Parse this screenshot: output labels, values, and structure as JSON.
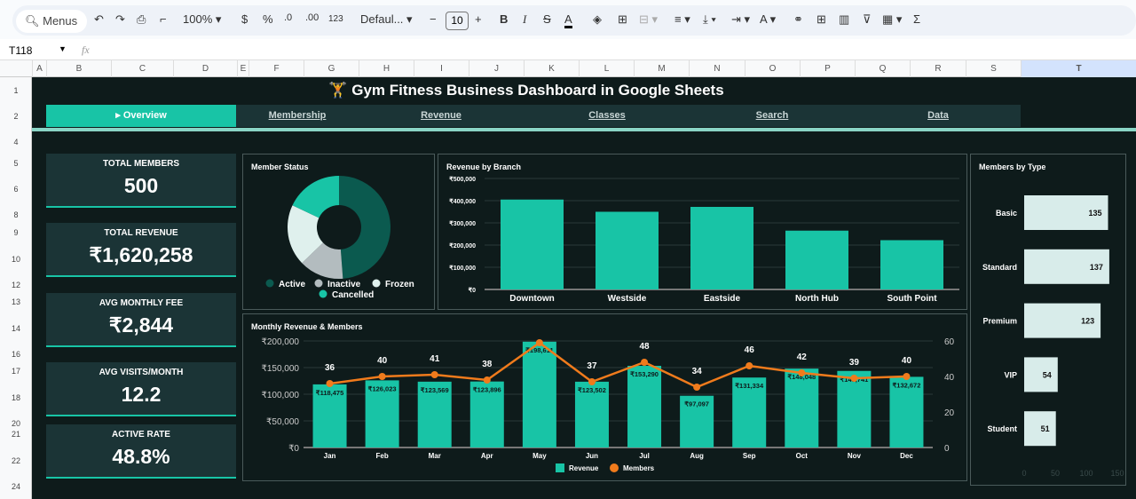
{
  "toolbar": {
    "menus": "Menus",
    "zoom": "100%",
    "currency": "$",
    "percent": "%",
    "dec_less": ".0",
    "dec_more": ".00",
    "format_123": "123",
    "font": "Defaul...",
    "font_size": "10",
    "bold": "B",
    "italic": "I",
    "sum": "Σ"
  },
  "formula_bar": {
    "cell_ref": "T118",
    "fx": "fx",
    "value": ""
  },
  "columns": [
    "A",
    "B",
    "C",
    "D",
    "E",
    "F",
    "G",
    "H",
    "I",
    "J",
    "K",
    "L",
    "M",
    "N",
    "O",
    "P",
    "Q",
    "R",
    "S",
    "T"
  ],
  "rows": [
    "1",
    "2",
    "4",
    "5",
    "6",
    "8",
    "9",
    "10",
    "12",
    "13",
    "14",
    "16",
    "17",
    "18",
    "20",
    "21",
    "22",
    "24"
  ],
  "dashboard": {
    "title": "🏋️ Gym Fitness Business Dashboard in Google Sheets",
    "nav": [
      "▸ Overview",
      "Membership",
      "Revenue",
      "Classes",
      "Search",
      "Data"
    ],
    "kpis": [
      {
        "label": "TOTAL MEMBERS",
        "value": "500"
      },
      {
        "label": "TOTAL REVENUE",
        "value": "₹1,620,258"
      },
      {
        "label": "AVG MONTHLY FEE",
        "value": "₹2,844"
      },
      {
        "label": "AVG VISITS/MONTH",
        "value": "12.2"
      },
      {
        "label": "ACTIVE RATE",
        "value": "48.8%"
      }
    ]
  },
  "colors": {
    "teal": "#18c4a6",
    "orange": "#f07b1c",
    "dark": "#0e1b1b",
    "panel": "#1b3436"
  },
  "chart_data": [
    {
      "type": "pie",
      "title": "Member Status",
      "labels": [
        "Active",
        "Inactive",
        "Frozen",
        "Cancelled"
      ],
      "values": [
        244,
        70,
        96,
        90
      ],
      "colors": [
        "#0b5a4f",
        "#b3bcbf",
        "#dff0ed",
        "#18c4a6"
      ],
      "legend": "bottom"
    },
    {
      "type": "bar",
      "title": "Revenue by Branch",
      "categories": [
        "Downtown",
        "Westside",
        "Eastside",
        "North Hub",
        "South Point"
      ],
      "values": [
        405000,
        350000,
        372000,
        265000,
        222000
      ],
      "ylim": [
        0,
        500000
      ],
      "yticks": [
        "₹0",
        "₹100,000",
        "₹200,000",
        "₹300,000",
        "₹400,000",
        "₹500,000"
      ]
    },
    {
      "type": "bar",
      "title": "Monthly Revenue & Members",
      "categories": [
        "Jan",
        "Feb",
        "Mar",
        "Apr",
        "May",
        "Jun",
        "Jul",
        "Aug",
        "Sep",
        "Oct",
        "Nov",
        "Dec"
      ],
      "series": [
        {
          "name": "Revenue",
          "type": "bar",
          "values": [
            118475,
            126023,
            123569,
            123896,
            198611,
            123502,
            153290,
            97097,
            131334,
            148048,
            143741,
            132672
          ],
          "labels": [
            "₹118,475",
            "₹126,023",
            "₹123,569",
            "₹123,896",
            "₹198,611",
            "₹123,502",
            "₹153,290",
            "₹97,097",
            "₹131,334",
            "₹148,048",
            "₹143,741",
            "₹132,672"
          ]
        },
        {
          "name": "Members",
          "type": "line",
          "axis": "right",
          "values": [
            36,
            40,
            41,
            38,
            59,
            37,
            48,
            34,
            46,
            42,
            39,
            40
          ],
          "labels": [
            "36",
            "40",
            "41",
            "38",
            "",
            "37",
            "48",
            "34",
            "46",
            "42",
            "39",
            "40"
          ]
        }
      ],
      "ylim": [
        0,
        200000
      ],
      "yticks": [
        "₹0",
        "₹50,000",
        "₹100,000",
        "₹150,000",
        "₹200,000"
      ],
      "y2lim": [
        0,
        60
      ],
      "y2ticks": [
        "0",
        "20",
        "40",
        "60"
      ],
      "legend": "bottom"
    },
    {
      "type": "bar",
      "orientation": "horizontal",
      "title": "Members by Type",
      "categories": [
        "Basic",
        "Standard",
        "Premium",
        "VIP",
        "Student"
      ],
      "values": [
        135,
        137,
        123,
        54,
        51
      ],
      "xlim": [
        0,
        150
      ],
      "xticks": [
        "0",
        "50",
        "100",
        "150"
      ]
    }
  ]
}
